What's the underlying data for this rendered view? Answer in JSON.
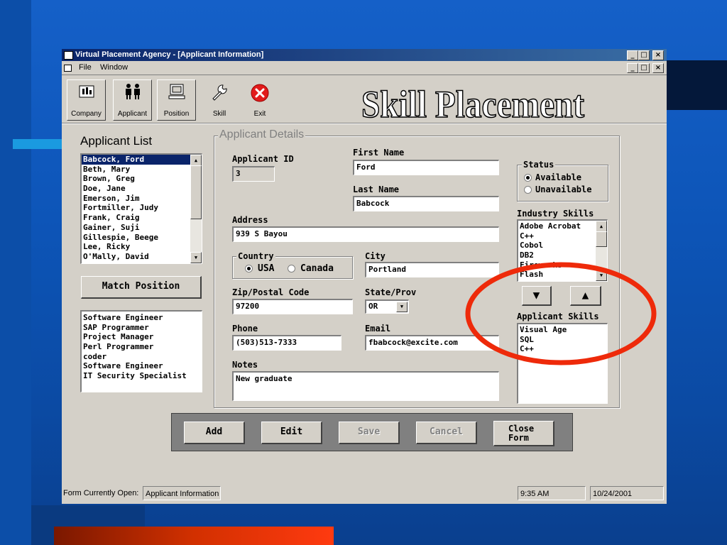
{
  "window": {
    "title": "Virtual Placement Agency - [Applicant Information]",
    "min_label": "_",
    "restore_label": "□",
    "close_label": "×"
  },
  "menu": {
    "file": "File",
    "window": "Window"
  },
  "toolbar": {
    "company": "Company",
    "applicant": "Applicant",
    "position": "Position",
    "skill": "Skill",
    "exit": "Exit"
  },
  "brand_title": "Skill Placement",
  "applicant_list": {
    "heading": "Applicant List",
    "items": [
      "Babcock, Ford",
      "Beth, Mary",
      "Brown, Greg",
      "Doe, Jane",
      "Emerson, Jim",
      "Fortmiller, Judy",
      "Frank, Craig",
      "Gainer, Suji",
      "Gillespie, Beege",
      "Lee, Ricky",
      "O'Mally, David"
    ],
    "selected_index": 0,
    "match_button": "Match Position",
    "positions": [
      "Software Engineer",
      "SAP Programmer",
      "Project Manager",
      "Perl Programmer",
      "coder",
      "Software Engineer",
      "IT Security Specialist"
    ]
  },
  "details": {
    "group_title": "Applicant Details",
    "applicant_id_label": "Applicant ID",
    "applicant_id": "3",
    "first_name_label": "First Name",
    "first_name": "Ford",
    "last_name_label": "Last Name",
    "last_name": "Babcock",
    "address_label": "Address",
    "address": "939 S Bayou",
    "country_label": "Country",
    "country_usa": "USA",
    "country_canada": "Canada",
    "country_selected": "USA",
    "city_label": "City",
    "city": "Portland",
    "zip_label": "Zip/Postal Code",
    "zip": "97200",
    "state_label": "State/Prov",
    "state": "OR",
    "phone_label": "Phone",
    "phone": "(503)513-7333",
    "email_label": "Email",
    "email": "fbabcock@excite.com",
    "notes_label": "Notes",
    "notes": "New graduate",
    "status_label": "Status",
    "status_available": "Available",
    "status_unavailable": "Unavailable",
    "status_selected": "Available",
    "industry_skills_label": "Industry Skills",
    "industry_skills": [
      "Adobe Acrobat",
      "C++",
      "Cobol",
      "DB2",
      "Fireworks",
      "Flash"
    ],
    "move_down": "▼",
    "move_up": "▲",
    "applicant_skills_label": "Applicant Skills",
    "applicant_skills": [
      "Visual Age",
      "SQL",
      "C++"
    ]
  },
  "actions": {
    "add": "Add",
    "edit": "Edit",
    "save": "Save",
    "cancel": "Cancel",
    "close_line1": "Close",
    "close_line2": "Form"
  },
  "status_bar": {
    "form_open_label": "Form Currently Open:",
    "form_open_value": "Applicant Information",
    "time": "9:35 AM",
    "date": "10/24/2001"
  },
  "colors": {
    "slide_blue": "#1560c8",
    "titlebar": "#0a246a",
    "window_face": "#d4d0c8",
    "highlight_ellipse": "#ee2a0a",
    "exit_red": "#e21b1b"
  }
}
